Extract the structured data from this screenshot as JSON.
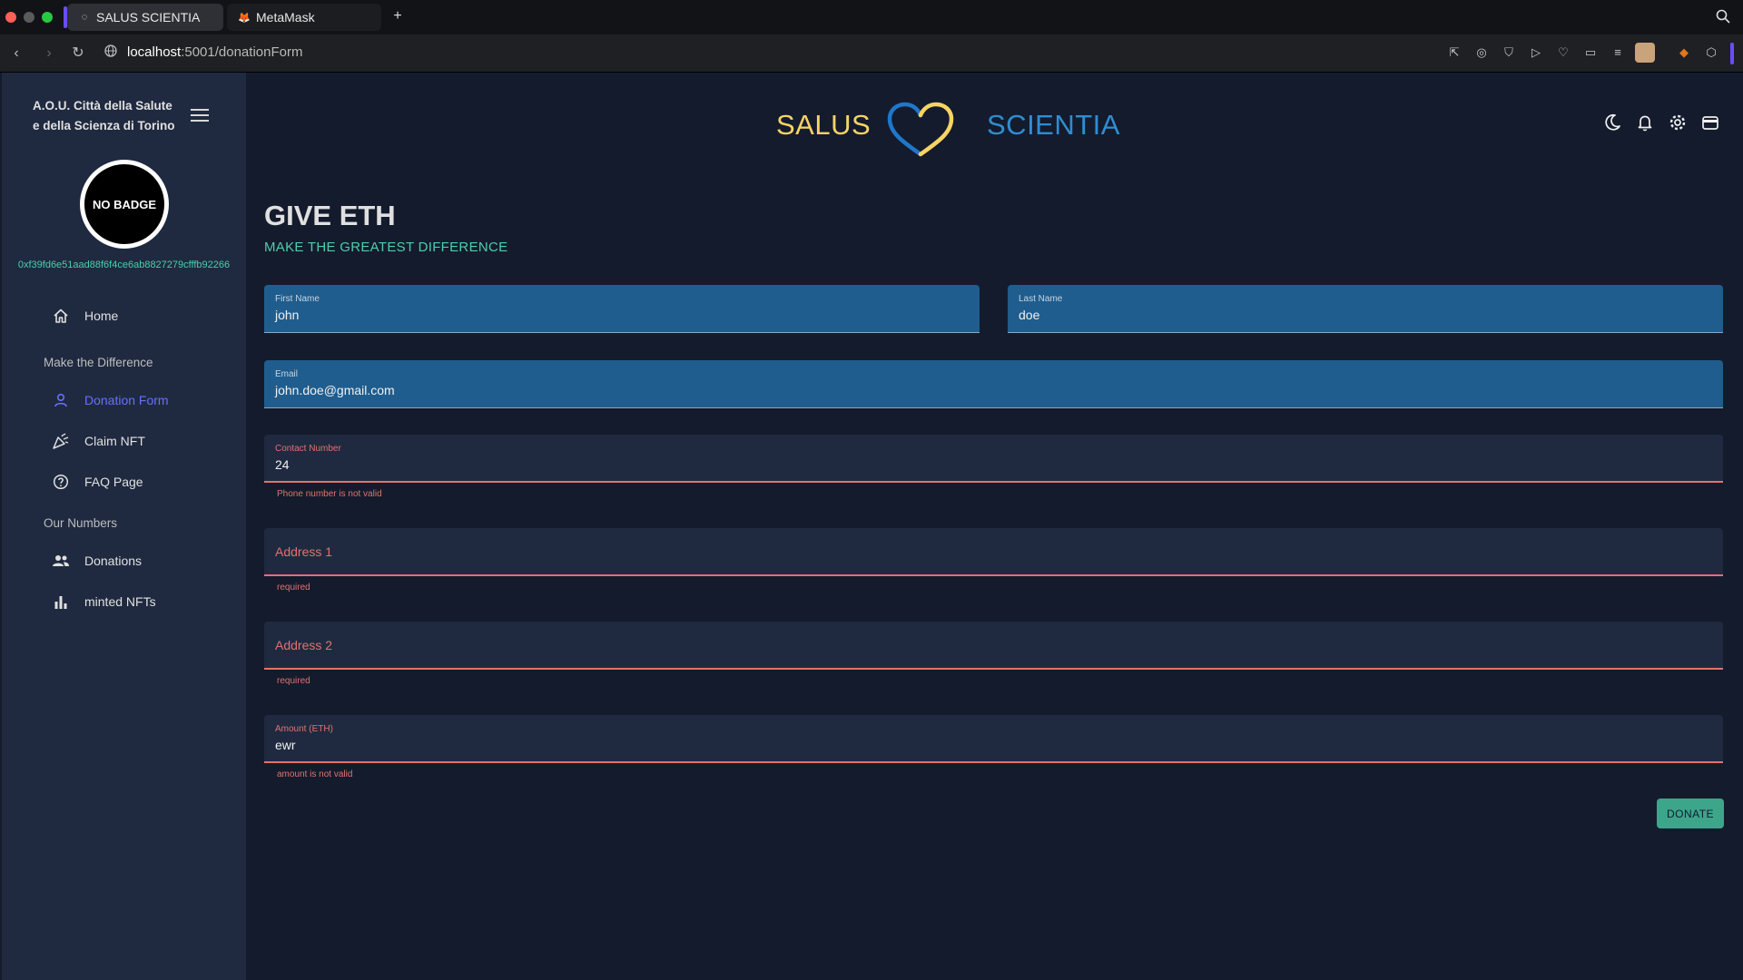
{
  "browser": {
    "tabs": [
      {
        "title": "SALUS SCIENTIA",
        "active": true
      },
      {
        "title": "MetaMask",
        "active": false
      }
    ],
    "url_host": "localhost",
    "url_path": ":5001/donationForm"
  },
  "sidebar": {
    "org_line1": "A.O.U. Città della Salute",
    "org_line2": "e della Scienza di Torino",
    "badge_text": "NO BADGE",
    "wallet_address": "0xf39fd6e51aad88f6f4ce6ab8827279cfffb92266",
    "home": "Home",
    "section1": "Make the Difference",
    "donation_form": "Donation Form",
    "claim_nft": "Claim NFT",
    "faq": "FAQ Page",
    "section2": "Our Numbers",
    "donations": "Donations",
    "minted_nfts": "minted NFTs"
  },
  "header": {
    "brand_left": "SALUS",
    "brand_right": "SCIENTIA"
  },
  "page": {
    "title": "GIVE ETH",
    "subtitle": "MAKE THE GREATEST DIFFERENCE"
  },
  "form": {
    "first_name": {
      "label": "First Name",
      "value": "john"
    },
    "last_name": {
      "label": "Last Name",
      "value": "doe"
    },
    "email": {
      "label": "Email",
      "value": "john.doe@gmail.com"
    },
    "contact": {
      "label": "Contact Number",
      "value": "24",
      "error": "Phone number is not valid"
    },
    "address1": {
      "placeholder": "Address 1",
      "error": "required"
    },
    "address2": {
      "placeholder": "Address 2",
      "error": "required"
    },
    "amount": {
      "label": "Amount (ETH)",
      "value": "ewr",
      "error": "amount is not valid"
    },
    "submit": "DONATE"
  },
  "colors": {
    "accent_green": "#4cceac",
    "active_nav": "#6870fa",
    "error": "#e2726e",
    "brand_yellow": "#f7d463",
    "brand_blue": "#2f8dd1"
  }
}
